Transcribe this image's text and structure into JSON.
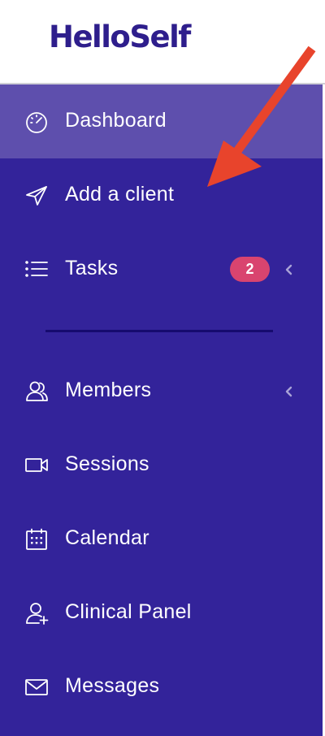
{
  "brand": {
    "logo_text": "HelloSelf"
  },
  "colors": {
    "brand": "#2e1e8c",
    "sidebar_bg": "#33239a",
    "active_bg": "#5e4fad",
    "badge_bg": "#d9446f",
    "divider": "#160b6e",
    "annotation_arrow": "#e8442c"
  },
  "sidebar": {
    "items": [
      {
        "label": "Dashboard",
        "icon": "speedometer-icon",
        "active": true
      },
      {
        "label": "Add a client",
        "icon": "send-icon"
      },
      {
        "label": "Tasks",
        "icon": "list-icon",
        "badge": "2",
        "has_chevron": true
      },
      {
        "label": "Members",
        "icon": "users-icon",
        "has_chevron": true
      },
      {
        "label": "Sessions",
        "icon": "video-icon"
      },
      {
        "label": "Calendar",
        "icon": "calendar-icon"
      },
      {
        "label": "Clinical Panel",
        "icon": "user-plus-icon"
      },
      {
        "label": "Messages",
        "icon": "mail-icon"
      }
    ]
  }
}
